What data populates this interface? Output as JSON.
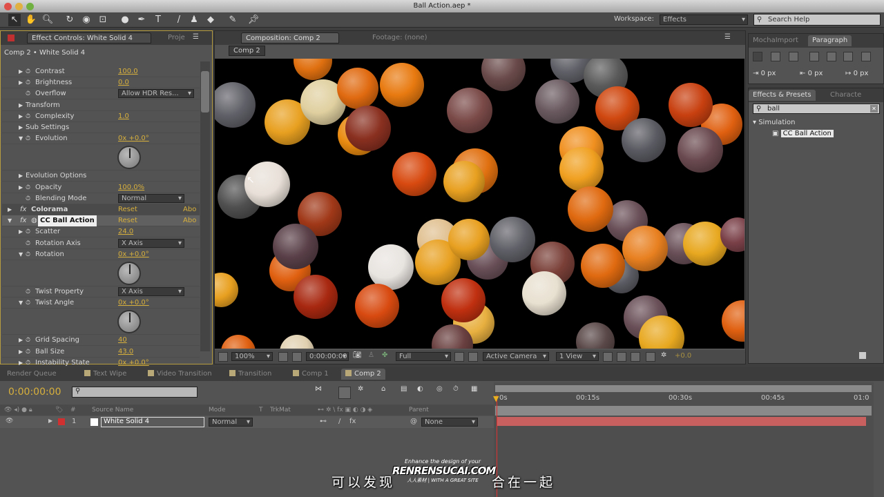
{
  "window": {
    "title": "Ball Action.aep *"
  },
  "toolbar": {
    "workspace_label": "Workspace:",
    "workspace_value": "Effects",
    "search_help_placeholder": "Search Help"
  },
  "effect_controls": {
    "tab_label": "Effect Controls: White Solid 4",
    "project_tab": "Proje",
    "breadcrumb": "Comp 2 • White Solid 4",
    "rows": [
      {
        "label": "Contrast",
        "value": "100.0",
        "twirl": "closed",
        "stopwatch": true,
        "depth": 2
      },
      {
        "label": "Brightness",
        "value": "0.0",
        "twirl": "closed",
        "stopwatch": true,
        "depth": 2
      },
      {
        "label": "Overflow",
        "dropdown": "Allow HDR Res...",
        "twirl": "none",
        "stopwatch": true,
        "depth": 2
      },
      {
        "label": "Transform",
        "twirl": "closed",
        "depth": 1
      },
      {
        "label": "Complexity",
        "value": "1.0",
        "twirl": "closed",
        "stopwatch": true,
        "depth": 2
      },
      {
        "label": "Sub Settings",
        "twirl": "closed",
        "depth": 1
      },
      {
        "label": "Evolution",
        "value": "0x +0.0°",
        "twirl": "open",
        "stopwatch": true,
        "depth": 2,
        "dial": true
      },
      {
        "label": "Evolution Options",
        "twirl": "closed",
        "depth": 1
      },
      {
        "label": "Opacity",
        "value": "100.0%",
        "twirl": "closed",
        "stopwatch": true,
        "depth": 2
      },
      {
        "label": "Blending Mode",
        "dropdown": "Normal",
        "twirl": "none",
        "stopwatch": true,
        "depth": 2
      },
      {
        "label": "Colorama",
        "reset": "Reset",
        "about": "Abo",
        "twirl": "closed",
        "fx": true,
        "depth": 0
      },
      {
        "label": "CC Ball Action",
        "reset": "Reset",
        "about": "Abo",
        "twirl": "open",
        "fx": true,
        "selected": true,
        "depth": 0
      },
      {
        "label": "Scatter",
        "value": "24.0",
        "twirl": "closed",
        "stopwatch": true,
        "depth": 2
      },
      {
        "label": "Rotation Axis",
        "dropdown": "X Axis",
        "twirl": "none",
        "stopwatch": true,
        "depth": 2
      },
      {
        "label": "Rotation",
        "value": "0x +0.0°",
        "twirl": "open",
        "stopwatch": true,
        "depth": 2,
        "dial": true
      },
      {
        "label": "Twist Property",
        "dropdown": "X Axis",
        "twirl": "none",
        "stopwatch": true,
        "depth": 2
      },
      {
        "label": "Twist Angle",
        "value": "0x +0.0°",
        "twirl": "open",
        "stopwatch": true,
        "depth": 2,
        "dial": true
      },
      {
        "label": "Grid Spacing",
        "value": "40",
        "twirl": "closed",
        "stopwatch": true,
        "depth": 2
      },
      {
        "label": "Ball Size",
        "value": "43.0",
        "twirl": "closed",
        "stopwatch": true,
        "depth": 2
      },
      {
        "label": "Instability State",
        "value": "0x +0.0°",
        "twirl": "closed",
        "stopwatch": true,
        "depth": 2
      }
    ]
  },
  "composition": {
    "tab_label": "Composition: Comp 2",
    "footage_tab": "Footage: (none)",
    "comp_button": "Comp 2",
    "bottom": {
      "zoom": "100%",
      "timecode": "0:00:00:00",
      "resolution": "Full",
      "camera": "Active Camera",
      "views": "1 View",
      "exposure": "+0.0"
    }
  },
  "right_panels": {
    "tabs_top": [
      "MochaImport",
      "Paragraph"
    ],
    "indent_values": [
      "0 px",
      "0 px",
      "0 px"
    ],
    "effects_tab": "Effects & Presets",
    "character_tab": "Characte",
    "search_value": "ball",
    "category": "Simulation",
    "result": "CC Ball Action"
  },
  "timeline": {
    "tabs": [
      "Render Queue",
      "Text Wipe",
      "Video Transition",
      "Transition",
      "Comp 1",
      "Comp 2"
    ],
    "current_time": "0:00:00:00",
    "columns": {
      "num": "#",
      "source": "Source Name",
      "mode": "Mode",
      "t": "T",
      "trkmat": "TrkMat",
      "parent": "Parent"
    },
    "layer": {
      "index": "1",
      "name": "White Solid 4",
      "mode": "Normal",
      "parent": "None",
      "label_color": "#d03030"
    },
    "ruler": [
      "0s",
      "00:15s",
      "00:30s",
      "00:45s",
      "01:0"
    ]
  },
  "subtitle": {
    "left": "可以发现",
    "right": "合在一起"
  },
  "watermark": {
    "top": "Enhance the design of your",
    "main": "RENRENSUCAI.COM",
    "cn": "人人素材",
    "tag": "WITH A GREAT SITE"
  },
  "colors": {
    "accent_value": "#d8b03c",
    "layer_bar": "#c86060",
    "playhead": "#e03030"
  }
}
